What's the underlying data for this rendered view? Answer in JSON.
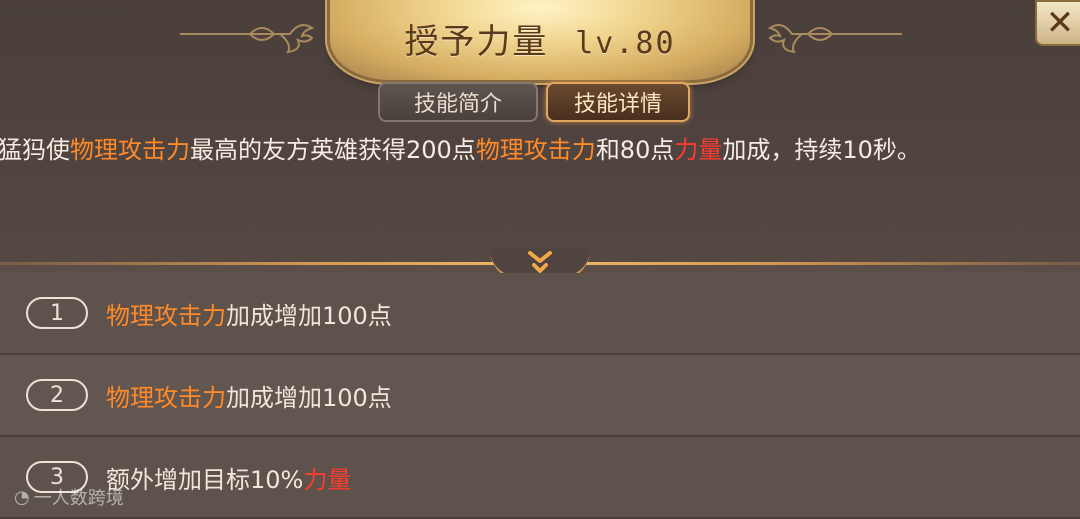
{
  "title": {
    "name": "授予力量",
    "level": "lv.80"
  },
  "tabs": [
    {
      "label": "技能简介",
      "active": false
    },
    {
      "label": "技能详情",
      "active": true
    }
  ],
  "description": {
    "p1": "猛犸使",
    "k1": "物理攻击力",
    "p2": "最高的友方英雄获得200点",
    "k2": "物理攻击力",
    "p3": "和80点",
    "k3": "力量",
    "p4": "加成，持续10秒。"
  },
  "upgrades": [
    {
      "num": "1",
      "highlight": "物理攻击力",
      "text": "加成增加100点",
      "highlight_after": ""
    },
    {
      "num": "2",
      "highlight": "物理攻击力",
      "text": "加成增加100点",
      "highlight_after": ""
    },
    {
      "num": "3",
      "highlight": "",
      "text": "额外增加目标10%",
      "highlight_after": "力量"
    }
  ],
  "watermark": "一人数跨境",
  "colors": {
    "keyword_orange": "#ff8a2a",
    "keyword_red": "#ff3b2e",
    "accent_gold": "#d89a52"
  },
  "icons": [
    "close-icon",
    "expand-chevron-icon",
    "title-ornament"
  ]
}
